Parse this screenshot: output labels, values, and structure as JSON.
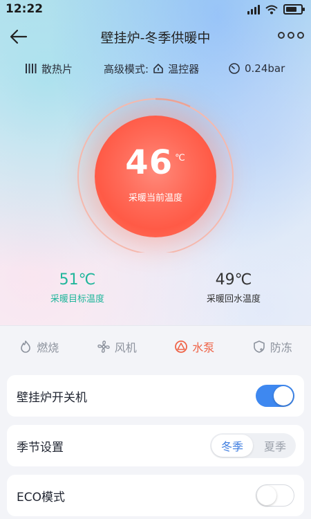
{
  "status_bar": {
    "time": "12:22"
  },
  "header": {
    "title": "壁挂炉-冬季供暖中"
  },
  "info_row": {
    "radiator_label": "散热片",
    "mode_label": "高级模式:",
    "mode_value": "温控器",
    "pressure": "0.24bar"
  },
  "dial": {
    "current_temp": "46",
    "unit": "℃",
    "label": "采暖当前温度"
  },
  "stats": {
    "target_temp": "51℃",
    "target_label": "采暖目标温度",
    "return_temp": "49℃",
    "return_label": "采暖回水温度"
  },
  "tabs": [
    {
      "label": "燃烧",
      "icon": "flame-icon",
      "active": false
    },
    {
      "label": "风机",
      "icon": "fan-icon",
      "active": false
    },
    {
      "label": "水泵",
      "icon": "pump-icon",
      "active": true
    },
    {
      "label": "防冻",
      "icon": "shield-icon",
      "active": false
    }
  ],
  "settings": {
    "power": {
      "label": "壁挂炉开关机",
      "on": true
    },
    "season": {
      "label": "季节设置",
      "options": [
        "冬季",
        "夏季"
      ],
      "selected": "冬季"
    },
    "eco": {
      "label": "ECO模式",
      "on": false
    }
  },
  "colors": {
    "accent_blue": "#3e88f0",
    "accent_green": "#20b69b",
    "active_tab": "#ef6448",
    "dial_red": "#ff5a46"
  }
}
